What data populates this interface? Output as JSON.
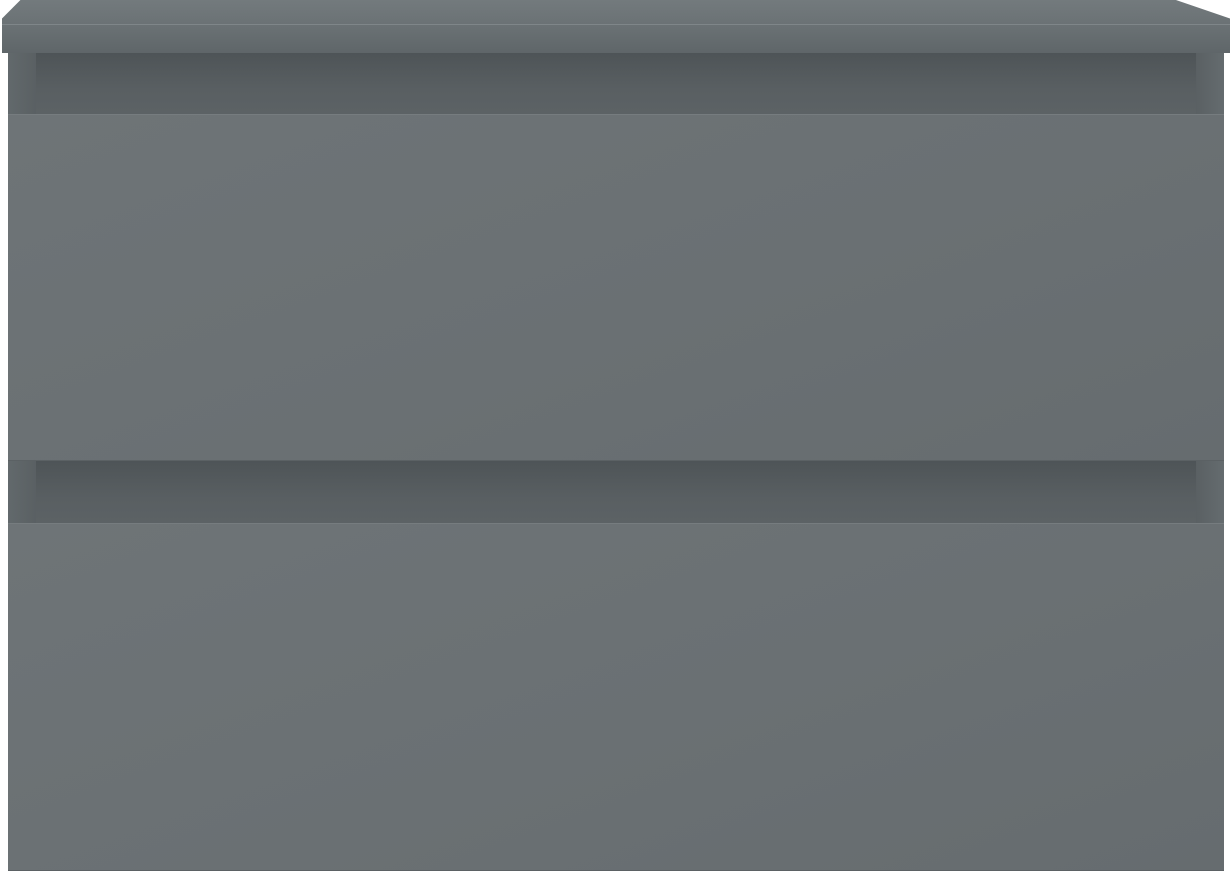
{
  "scene": {
    "subject": "wall-hung-vanity-cabinet",
    "colors": {
      "body": "#6a7073",
      "recess": "#53595c",
      "top": "#6e7578",
      "background": "#ffffff"
    },
    "drawer_count": 2
  }
}
